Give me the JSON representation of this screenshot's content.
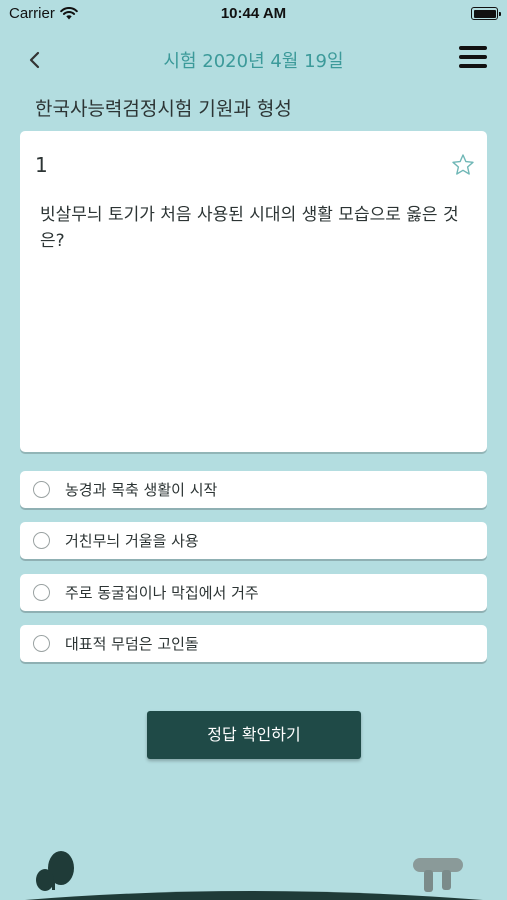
{
  "status_bar": {
    "carrier": "Carrier",
    "time": "10:44 AM"
  },
  "nav": {
    "title": "시험 2020년 4월 19일"
  },
  "page_title": "한국사능력검정시험 기원과 형성",
  "question": {
    "number": "1",
    "text": "빗살무늬 토기가 처음 사용된 시대의 생활 모습으로 옳은 것은?"
  },
  "options": [
    "농경과 목축 생활이 시작",
    "거친무늬 거울을 사용",
    "주로 동굴집이나 막집에서 거주",
    "대표적 무덤은 고인돌"
  ],
  "check_button": "정답 확인하기",
  "colors": {
    "background": "#b3dde0",
    "accent": "#3c9a9a",
    "button": "#1f4a47",
    "ground": "#1f3b38"
  }
}
